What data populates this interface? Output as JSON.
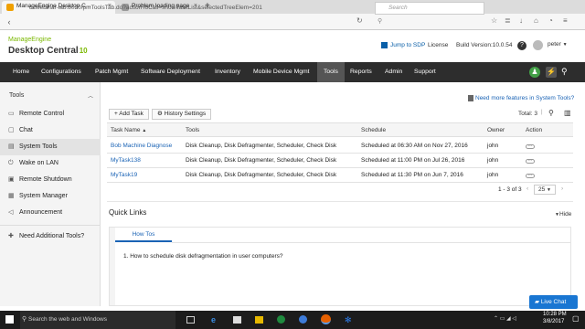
{
  "browser": {
    "tabs": [
      {
        "title": "ManageEngine Desktop C..."
      },
      {
        "title": "Problem loading page"
      }
    ],
    "new_tab": "+",
    "url": "dcwebinar-lab:8020/pmToolsTab.do?actionToCall=showTaskList&selectedTreeElem=201",
    "search_placeholder": "Search"
  },
  "header": {
    "brand_top": "ManageEngine",
    "product": "Desktop Central",
    "version_badge": "10",
    "jump_to_sdp": "Jump to SDP",
    "license": "License",
    "build": "Build Version:10.0.54",
    "help": "?",
    "user": "peter"
  },
  "nav": {
    "items": [
      "Home",
      "Configurations",
      "Patch Mgmt",
      "Software Deployment",
      "Inventory",
      "Mobile Device Mgmt",
      "Tools",
      "Reports",
      "Admin",
      "Support"
    ],
    "active": "Tools"
  },
  "sidebar": {
    "title": "Tools",
    "items": [
      "Remote Control",
      "Chat",
      "System Tools",
      "Wake on LAN",
      "Remote Shutdown",
      "System Manager",
      "Announcement"
    ],
    "active": "System Tools",
    "help": "Need Additional Tools?"
  },
  "toolbar": {
    "add_task": "Add Task",
    "history_settings": "History Settings",
    "more_features": "Need more features in System Tools?",
    "total": "Total: 3"
  },
  "table": {
    "columns": [
      "Task Name",
      "Tools",
      "Schedule",
      "Owner",
      "Action"
    ],
    "rows": [
      {
        "name": "Bob Machine Diagnose",
        "tools": "Disk Cleanup, Disk Defragmenter, Scheduler, Check Disk",
        "schedule": "Scheduled at 06:30 AM on Nov 27, 2016",
        "owner": "john",
        "action": "···"
      },
      {
        "name": "MyTask138",
        "tools": "Disk Cleanup, Disk Defragmenter, Scheduler, Check Disk",
        "schedule": "Scheduled at 11:00 PM on Jul 26, 2016",
        "owner": "john",
        "action": "···"
      },
      {
        "name": "MyTask19",
        "tools": "Disk Cleanup, Disk Defragmenter, Scheduler, Check Disk",
        "schedule": "Scheduled at 11:30 PM on Jun 7, 2016",
        "owner": "john",
        "action": "···"
      }
    ],
    "pagination": "1 - 3 of 3",
    "per_page": "25"
  },
  "quick_links": {
    "title": "Quick Links",
    "hide": "Hide",
    "tab": "How Tos",
    "items": [
      "1. How to schedule disk defragmentation in user computers?"
    ]
  },
  "live_chat": "Live Chat",
  "taskbar": {
    "search_placeholder": "Search the web and Windows",
    "time": "10:28 PM",
    "date": "3/8/2017"
  },
  "colors": {
    "nav_bg": "#2d2d2d",
    "accent_green": "#7ab800",
    "link_blue": "#1a63b5",
    "chat_blue": "#1976d2"
  }
}
